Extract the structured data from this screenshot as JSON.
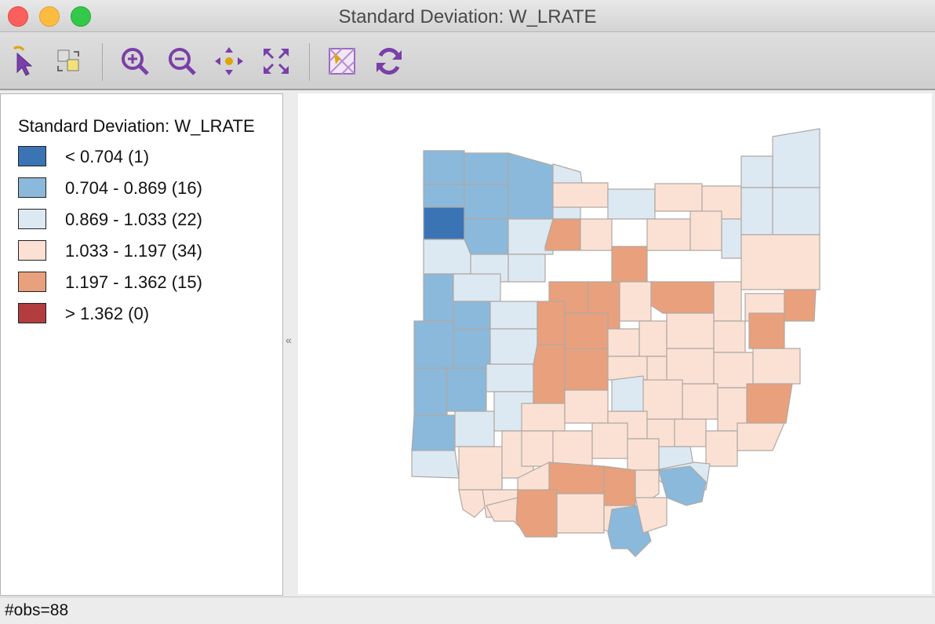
{
  "window": {
    "title": "Standard Deviation: W_LRATE"
  },
  "toolbar": {
    "tools": [
      {
        "name": "select-tool",
        "icon": "arrow-pointer-icon"
      },
      {
        "name": "selection-options-tool",
        "icon": "selection-swap-icon"
      },
      {
        "name": "zoom-in-tool",
        "icon": "zoom-in-icon"
      },
      {
        "name": "zoom-out-tool",
        "icon": "zoom-out-icon"
      },
      {
        "name": "pan-tool",
        "icon": "pan-arrows-icon"
      },
      {
        "name": "fit-extent-tool",
        "icon": "fit-extent-icon"
      },
      {
        "name": "basemap-tool",
        "icon": "basemap-icon"
      },
      {
        "name": "refresh-tool",
        "icon": "refresh-icon"
      }
    ]
  },
  "legend": {
    "title": "Standard Deviation: W_LRATE",
    "items": [
      {
        "label": "< 0.704 (1)",
        "color": "#3a74b4"
      },
      {
        "label": "0.704 - 0.869 (16)",
        "color": "#8ab9dc"
      },
      {
        "label": "0.869 - 1.033 (22)",
        "color": "#dce9f3"
      },
      {
        "label": "1.033 - 1.197 (34)",
        "color": "#fbe1d4"
      },
      {
        "label": "1.197 - 1.362 (15)",
        "color": "#e9a07d"
      },
      {
        "label": "> 1.362 (0)",
        "color": "#b33c3f"
      }
    ]
  },
  "status": {
    "obs": "#obs=88"
  },
  "colors": {
    "outline": "#b0a9a4",
    "class_1": "#3a74b4",
    "class_2": "#8ab9dc",
    "class_3": "#dce9f3",
    "class_4": "#fbe1d4",
    "class_5": "#e9a07d",
    "class_6": "#b33c3f"
  }
}
